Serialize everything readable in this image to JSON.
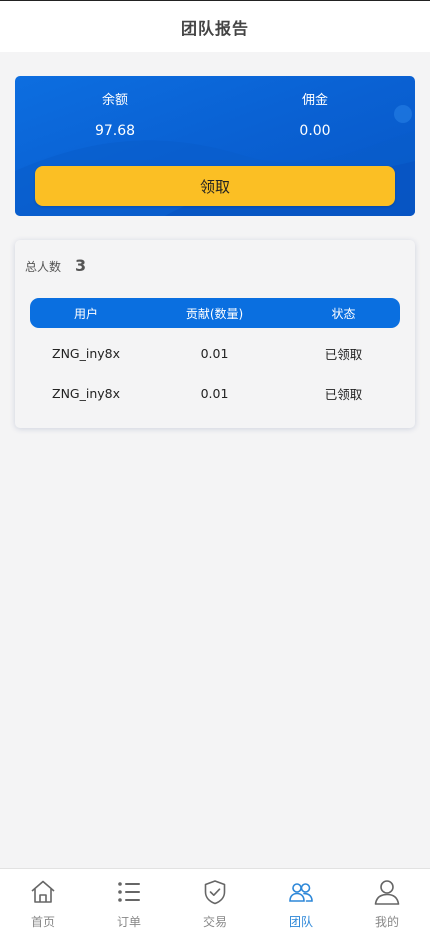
{
  "header": {
    "title": "团队报告"
  },
  "balance": {
    "left_label": "余额",
    "left_value": "97.68",
    "right_label": "佣金",
    "right_value": "0.00",
    "claim_label": "领取"
  },
  "team": {
    "total_label": "总人数",
    "total_value": "3",
    "columns": [
      "用户",
      "贡献(数量)",
      "状态"
    ],
    "rows": [
      {
        "user": "ZNG_iny8x",
        "contribution": "0.01",
        "status": "已领取"
      },
      {
        "user": "ZNG_iny8x",
        "contribution": "0.01",
        "status": "已领取"
      }
    ]
  },
  "tabbar": {
    "items": [
      {
        "label": "首页",
        "icon": "home-icon"
      },
      {
        "label": "订单",
        "icon": "list-icon"
      },
      {
        "label": "交易",
        "icon": "shield-check-icon"
      },
      {
        "label": "团队",
        "icon": "team-icon",
        "active": true
      },
      {
        "label": "我的",
        "icon": "user-icon"
      }
    ]
  },
  "colors": {
    "primary": "#0a6fe0",
    "button": "#fbbf24",
    "active_tab": "#2d87d8",
    "inactive_tab": "#888888"
  }
}
